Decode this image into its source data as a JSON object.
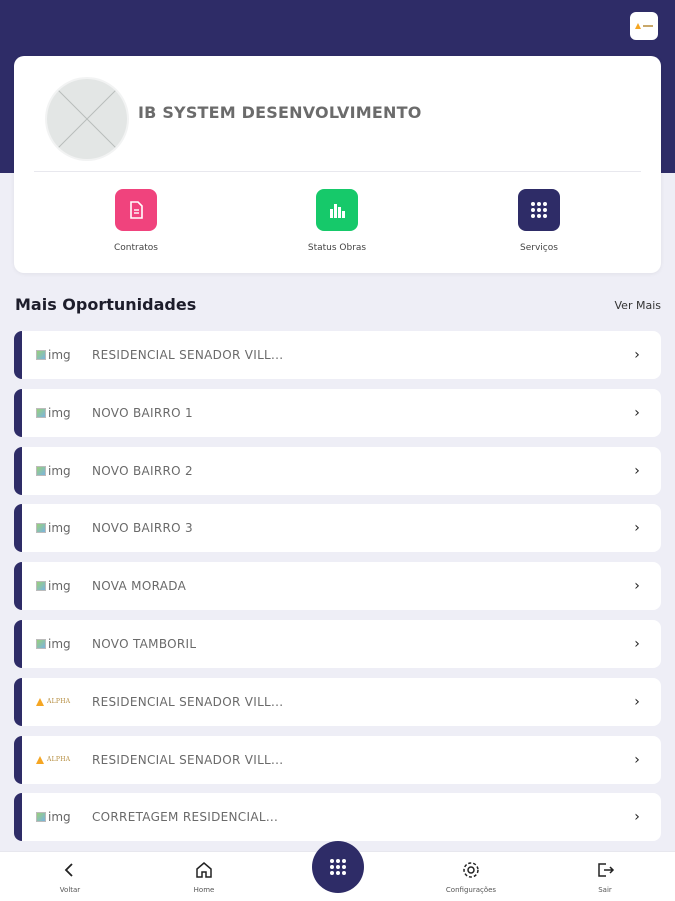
{
  "colors": {
    "header": "#2e2c67",
    "background": "#eeeef6",
    "contratos": "#f0437d",
    "status_obras": "#16c96a",
    "servicos": "#2e2c67"
  },
  "profile": {
    "company_name": "IB SYSTEM DESENVOLVIMENTO"
  },
  "actions": [
    {
      "label": "Contratos",
      "icon": "document-icon"
    },
    {
      "label": "Status Obras",
      "icon": "bar-chart-icon"
    },
    {
      "label": "Serviços",
      "icon": "grid-icon"
    }
  ],
  "section": {
    "title": "Mais Oportunidades",
    "see_more": "Ver Mais"
  },
  "opportunities": [
    {
      "thumb": "img",
      "label": "RESIDENCIAL SENADOR VILL..."
    },
    {
      "thumb": "img",
      "label": "NOVO BAIRRO 1"
    },
    {
      "thumb": "img",
      "label": "NOVO BAIRRO 2"
    },
    {
      "thumb": "img",
      "label": "NOVO BAIRRO 3"
    },
    {
      "thumb": "img",
      "label": "NOVA MORADA"
    },
    {
      "thumb": "img",
      "label": "NOVO TAMBORIL"
    },
    {
      "thumb": "ALPHA",
      "label": "RESIDENCIAL SENADOR VILL..."
    },
    {
      "thumb": "ALPHA",
      "label": "RESIDENCIAL SENADOR VILL..."
    },
    {
      "thumb": "img",
      "label": "CORRETAGEM RESIDENCIAL..."
    }
  ],
  "bottom_nav": {
    "back": "Voltar",
    "home": "Home",
    "settings": "Configurações",
    "exit": "Sair"
  }
}
